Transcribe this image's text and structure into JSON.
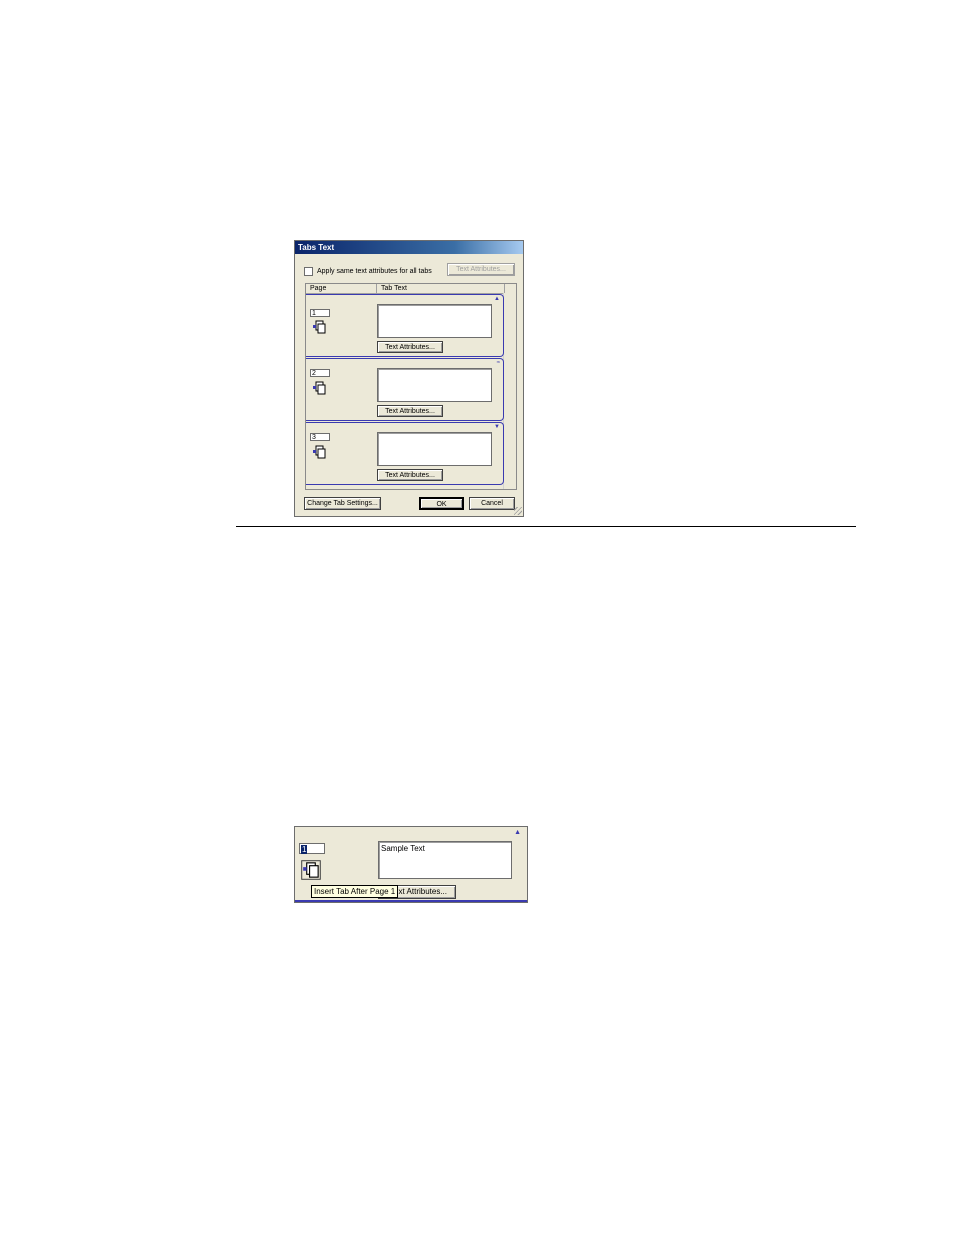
{
  "dialog": {
    "title": "Tabs Text",
    "apply_same_label": "Apply same text attributes for all tabs",
    "text_attributes_top": "Text Attributes...",
    "columns": {
      "page": "Page",
      "tab_text": "Tab Text"
    },
    "entries": [
      {
        "page": "1",
        "text": "",
        "button": "Text Attributes..."
      },
      {
        "page": "2",
        "text": "",
        "button": "Text Attributes..."
      },
      {
        "page": "3",
        "text": "",
        "button": "Text Attributes..."
      }
    ],
    "change_tab_settings": "Change Tab Settings...",
    "ok": "OK",
    "cancel": "Cancel"
  },
  "detail": {
    "page": "1",
    "text": "Sample Text",
    "button_partial": "xt Attributes...",
    "tooltip": "Insert Tab After Page 1"
  },
  "colors": {
    "titlebar": "#0a246a",
    "entry_border": "#3a3ab0",
    "dialog_bg": "#ece9d8"
  }
}
